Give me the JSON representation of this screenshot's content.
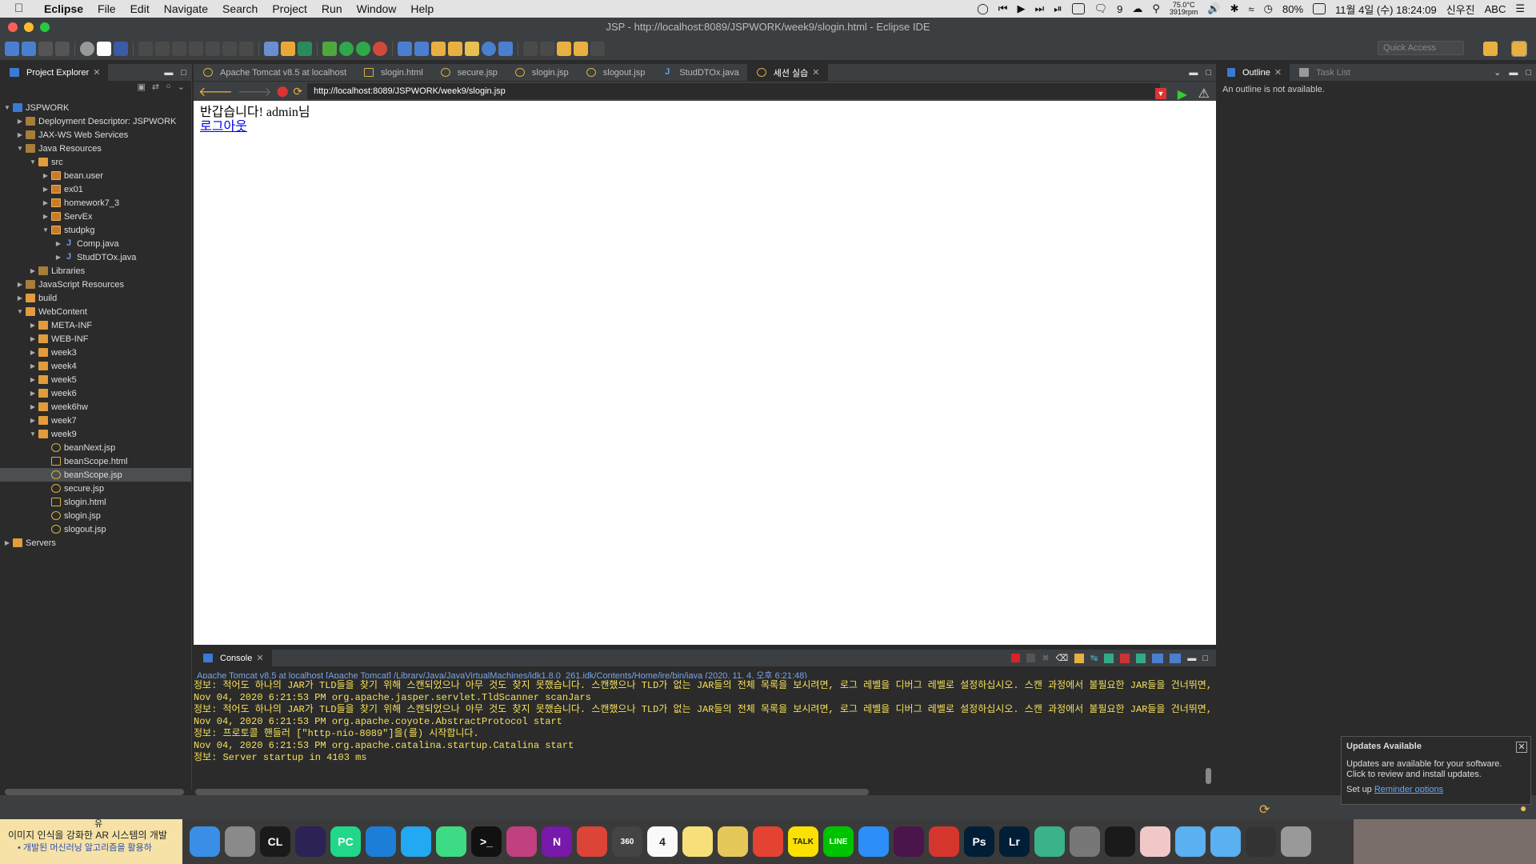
{
  "menubar": {
    "app_name": "Eclipse",
    "items": [
      "File",
      "Edit",
      "Navigate",
      "Search",
      "Project",
      "Run",
      "Window",
      "Help"
    ],
    "temp": "75.0°C",
    "rpm": "3919rpm",
    "battery": "80%",
    "datetime": "11월 4일 (수) 18:24:09",
    "user": "신우진",
    "input_source": "ABC",
    "notif_count": "9"
  },
  "window": {
    "title": "JSP - http://localhost:8089/JSPWORK/week9/slogin.html - Eclipse IDE"
  },
  "toolbar": {
    "quick_access": "Quick Access"
  },
  "explorer": {
    "tab_label": "Project Explorer",
    "tree": [
      {
        "label": "JSPWORK",
        "depth": 0,
        "icon": "proj",
        "open": true
      },
      {
        "label": "Deployment Descriptor: JSPWORK",
        "depth": 1,
        "icon": "lib",
        "open": false
      },
      {
        "label": "JAX-WS Web Services",
        "depth": 1,
        "icon": "lib",
        "open": false
      },
      {
        "label": "Java Resources",
        "depth": 1,
        "icon": "lib",
        "open": true
      },
      {
        "label": "src",
        "depth": 2,
        "icon": "folder",
        "open": true
      },
      {
        "label": "bean.user",
        "depth": 3,
        "icon": "pkg",
        "open": false
      },
      {
        "label": "ex01",
        "depth": 3,
        "icon": "pkg",
        "open": false
      },
      {
        "label": "homework7_3",
        "depth": 3,
        "icon": "pkg",
        "open": false
      },
      {
        "label": "ServEx",
        "depth": 3,
        "icon": "pkg",
        "open": false
      },
      {
        "label": "studpkg",
        "depth": 3,
        "icon": "pkg",
        "open": true
      },
      {
        "label": "Comp.java",
        "depth": 4,
        "icon": "java",
        "open": false
      },
      {
        "label": "StudDTOx.java",
        "depth": 4,
        "icon": "java",
        "open": false
      },
      {
        "label": "Libraries",
        "depth": 2,
        "icon": "lib",
        "open": false
      },
      {
        "label": "JavaScript Resources",
        "depth": 1,
        "icon": "lib",
        "open": false
      },
      {
        "label": "build",
        "depth": 1,
        "icon": "folder",
        "open": false
      },
      {
        "label": "WebContent",
        "depth": 1,
        "icon": "folder",
        "open": true
      },
      {
        "label": "META-INF",
        "depth": 2,
        "icon": "folder",
        "open": false
      },
      {
        "label": "WEB-INF",
        "depth": 2,
        "icon": "folder",
        "open": false
      },
      {
        "label": "week3",
        "depth": 2,
        "icon": "folder",
        "open": false
      },
      {
        "label": "week4",
        "depth": 2,
        "icon": "folder",
        "open": false
      },
      {
        "label": "week5",
        "depth": 2,
        "icon": "folder",
        "open": false
      },
      {
        "label": "week6",
        "depth": 2,
        "icon": "folder",
        "open": false
      },
      {
        "label": "week6hw",
        "depth": 2,
        "icon": "folder",
        "open": false
      },
      {
        "label": "week7",
        "depth": 2,
        "icon": "folder",
        "open": false
      },
      {
        "label": "week9",
        "depth": 2,
        "icon": "folder",
        "open": true
      },
      {
        "label": "beanNext.jsp",
        "depth": 3,
        "icon": "jsp",
        "leaf": true
      },
      {
        "label": "beanScope.html",
        "depth": 3,
        "icon": "html",
        "leaf": true
      },
      {
        "label": "beanScope.jsp",
        "depth": 3,
        "icon": "jsp",
        "leaf": true,
        "selected": true
      },
      {
        "label": "secure.jsp",
        "depth": 3,
        "icon": "jsp",
        "leaf": true
      },
      {
        "label": "slogin.html",
        "depth": 3,
        "icon": "html",
        "leaf": true
      },
      {
        "label": "slogin.jsp",
        "depth": 3,
        "icon": "jsp",
        "leaf": true
      },
      {
        "label": "slogout.jsp",
        "depth": 3,
        "icon": "jsp",
        "leaf": true
      },
      {
        "label": "Servers",
        "depth": 0,
        "icon": "folder",
        "open": false
      }
    ]
  },
  "editor": {
    "tabs": [
      "Apache Tomcat v8.5 at localhost",
      "slogin.html",
      "secure.jsp",
      "slogin.jsp",
      "slogout.jsp",
      "StudDTOx.java",
      "세션 실습"
    ],
    "active_tab": 6,
    "url": "http://localhost:8089/JSPWORK/week9/slogin.jsp",
    "page_text": "반갑습니다! admin님",
    "page_link": "로그아웃"
  },
  "outline": {
    "tab_label": "Outline",
    "tab2_label": "Task List",
    "message": "An outline is not available."
  },
  "console": {
    "tab_label": "Console",
    "process": "Apache Tomcat v8.5 at localhost [Apache Tomcat] /Library/Java/JavaVirtualMachines/jdk1.8.0_261.jdk/Contents/Home/jre/bin/java (2020. 11. 4. 오후 6:21:48)",
    "lines": [
      "정보: 적어도 하나의 JAR가 TLD들을 찾기 위해 스캔되었으나 아무 것도 찾지 못했습니다. 스캔했으나 TLD가 없는 JAR들의 전체 목록을 보시려면, 로그 레벨을 디버그 레벨로 설정하십시오. 스캔 과정에서 불필요한 JAR들을 건너뛰면, 시스템",
      "Nov 04, 2020 6:21:53 PM org.apache.jasper.servlet.TldScanner scanJars",
      "정보: 적어도 하나의 JAR가 TLD들을 찾기 위해 스캔되었으나 아무 것도 찾지 못했습니다. 스캔했으나 TLD가 없는 JAR들의 전체 목록을 보시려면, 로그 레벨을 디버그 레벨로 설정하십시오. 스캔 과정에서 불필요한 JAR들을 건너뛰면, 시스템",
      "Nov 04, 2020 6:21:53 PM org.apache.coyote.AbstractProtocol start",
      "정보: 프로토콜 핸들러 [\"http-nio-8089\"]을(를) 시작합니다.",
      "Nov 04, 2020 6:21:53 PM org.apache.catalina.startup.Catalina start",
      "정보: Server startup in 4103 ms"
    ]
  },
  "updates": {
    "title": "Updates Available",
    "line1": "Updates are available for your software.",
    "line2": "Click to review and install updates.",
    "prefix": "Set up ",
    "link": "Reminder options"
  },
  "dock": {
    "notice_title": "이미지 인식을 강화한 AR 시스템의 개발",
    "notice_sub": "• 개발된 머신러닝 알고리즘을 활용하",
    "notice_top": "유",
    "apps": [
      {
        "name": "finder",
        "color": "#3a8ee6",
        "label": ""
      },
      {
        "name": "launchpad",
        "color": "#8a8a8a",
        "label": ""
      },
      {
        "name": "clion",
        "color": "#1a1a1a",
        "label": "CL"
      },
      {
        "name": "eclipse",
        "color": "#2c2255",
        "label": ""
      },
      {
        "name": "pycharm",
        "color": "#21d789",
        "label": "PC"
      },
      {
        "name": "xcode",
        "color": "#1c7ed6",
        "label": ""
      },
      {
        "name": "vscode",
        "color": "#23a8f2",
        "label": ""
      },
      {
        "name": "android-studio",
        "color": "#3ddc84",
        "label": ""
      },
      {
        "name": "terminal",
        "color": "#111",
        "label": ">_"
      },
      {
        "name": "intellij",
        "color": "#c04080",
        "label": ""
      },
      {
        "name": "onenote",
        "color": "#7719aa",
        "label": "N"
      },
      {
        "name": "chrome",
        "color": "#db4437",
        "label": ""
      },
      {
        "name": "360",
        "color": "#444",
        "label": "360"
      },
      {
        "name": "calendar",
        "color": "#fafafa",
        "label": "4"
      },
      {
        "name": "notes",
        "color": "#f7e07a",
        "label": ""
      },
      {
        "name": "stickies",
        "color": "#e6c85a",
        "label": ""
      },
      {
        "name": "todoist",
        "color": "#e44332",
        "label": ""
      },
      {
        "name": "kakaotalk",
        "color": "#fae100",
        "label": "TALK"
      },
      {
        "name": "line",
        "color": "#00c300",
        "label": "LINE"
      },
      {
        "name": "messages",
        "color": "#2c8ef8",
        "label": ""
      },
      {
        "name": "slack",
        "color": "#4a154b",
        "label": ""
      },
      {
        "name": "remote-desktop",
        "color": "#d4362e",
        "label": ""
      },
      {
        "name": "photoshop",
        "color": "#001e36",
        "label": "Ps"
      },
      {
        "name": "lightroom",
        "color": "#001e36",
        "label": "Lr"
      },
      {
        "name": "brain",
        "color": "#3ab28a",
        "label": ""
      },
      {
        "name": "system-preferences",
        "color": "#777",
        "label": ""
      },
      {
        "name": "activity-monitor",
        "color": "#1a1a1a",
        "label": ""
      },
      {
        "name": "anime-app",
        "color": "#f0c8c8",
        "label": ""
      },
      {
        "name": "folder-downloads",
        "color": "#5ab0f0",
        "label": ""
      },
      {
        "name": "folder-documents",
        "color": "#5ab0f0",
        "label": ""
      },
      {
        "name": "archive",
        "color": "#333",
        "label": ""
      },
      {
        "name": "trash",
        "color": "#999",
        "label": ""
      }
    ]
  },
  "colors": {
    "accent": "#4b6eaf",
    "console_text": "#f5e05a"
  }
}
